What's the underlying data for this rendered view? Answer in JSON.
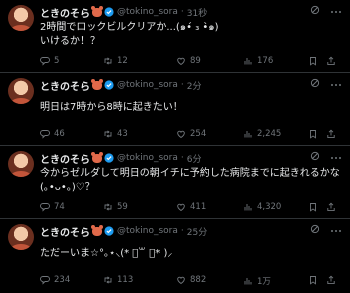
{
  "tweets": [
    {
      "name": "ときのそら",
      "handle": "@tokino_sora",
      "dot": "·",
      "time": "31秒",
      "text": "2時間でロックビルクリアか...(๑•́ ₃ •̀๑)\nいけるか！？",
      "replies": "5",
      "retweets": "12",
      "likes": "89",
      "views": "176"
    },
    {
      "name": "ときのそら",
      "handle": "@tokino_sora",
      "dot": "·",
      "time": "2分",
      "text": "明日は7時から8時に起きたい！",
      "replies": "46",
      "retweets": "43",
      "likes": "254",
      "views": "2,245"
    },
    {
      "name": "ときのそら",
      "handle": "@tokino_sora",
      "dot": "·",
      "time": "6分",
      "text": "今からゼルダして明日の朝イチに予約した病院までに起きれるかな\n(｡•ᴗ•｡)♡？",
      "replies": "74",
      "retweets": "59",
      "likes": "411",
      "views": "4,320"
    },
    {
      "name": "ときのそら",
      "handle": "@tokino_sora",
      "dot": "·",
      "time": "25分",
      "text": "ただーいま☆°｡⋆⸜(* ॑꒳ ॑* )⸝",
      "replies": "234",
      "retweets": "113",
      "likes": "882",
      "views": "1万"
    }
  ],
  "colors": {
    "background": "#000000",
    "text": "#e7e9ea",
    "muted": "#71767b",
    "verified": "#1d9bf0",
    "divider": "#2f3336"
  },
  "icons": [
    "reply-icon",
    "retweet-icon",
    "like-icon",
    "views-icon",
    "bookmark-icon",
    "share-icon",
    "grok-icon",
    "more-icon",
    "verified-icon",
    "bear-emoji-icon"
  ]
}
